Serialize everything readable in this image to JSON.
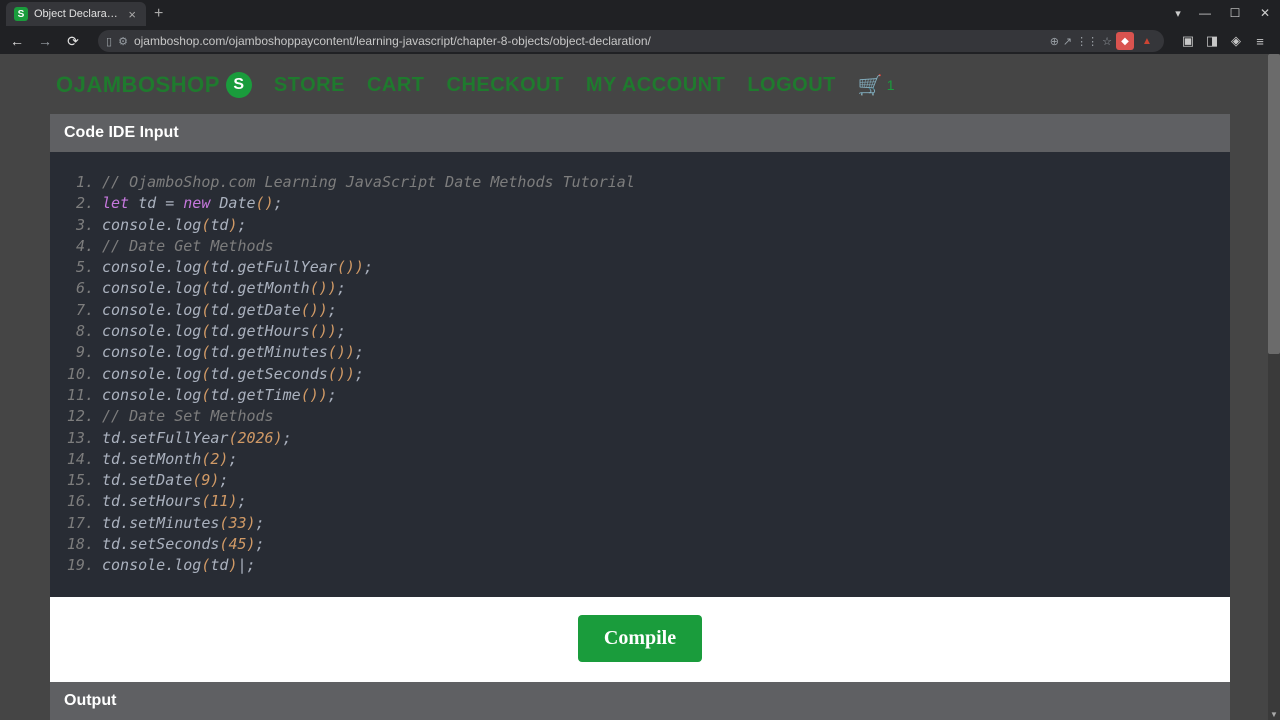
{
  "browser": {
    "tab_title": "Object Declaration - Ojamb",
    "url": "ojamboshop.com/ojamboshoppaycontent/learning-javascript/chapter-8-objects/object-declaration/"
  },
  "header": {
    "brand": "OJAMBOSHOP",
    "nav": [
      "STORE",
      "CART",
      "CHECKOUT",
      "MY ACCOUNT",
      "LOGOUT"
    ],
    "cart_count": "1"
  },
  "panel": {
    "title": "Code IDE Input"
  },
  "code": {
    "lines": [
      {
        "n": 1,
        "tokens": [
          [
            "comment",
            "// OjamboShop.com Learning JavaScript Date Methods Tutorial"
          ]
        ]
      },
      {
        "n": 2,
        "tokens": [
          [
            "kw",
            "let"
          ],
          [
            "plain",
            " "
          ],
          [
            "id",
            "td"
          ],
          [
            "plain",
            " = "
          ],
          [
            "kw",
            "new"
          ],
          [
            "plain",
            " "
          ],
          [
            "id",
            "Date"
          ],
          [
            "paren",
            "("
          ],
          [
            "paren",
            ")"
          ],
          [
            "plain",
            ";"
          ]
        ]
      },
      {
        "n": 3,
        "tokens": [
          [
            "id",
            "console"
          ],
          [
            "plain",
            "."
          ],
          [
            "fn",
            "log"
          ],
          [
            "paren",
            "("
          ],
          [
            "id",
            "td"
          ],
          [
            "paren",
            ")"
          ],
          [
            "plain",
            ";"
          ]
        ]
      },
      {
        "n": 4,
        "tokens": [
          [
            "comment",
            "// Date Get Methods"
          ]
        ]
      },
      {
        "n": 5,
        "tokens": [
          [
            "id",
            "console"
          ],
          [
            "plain",
            "."
          ],
          [
            "fn",
            "log"
          ],
          [
            "paren",
            "("
          ],
          [
            "id",
            "td"
          ],
          [
            "plain",
            "."
          ],
          [
            "id",
            "getFullYear"
          ],
          [
            "paren",
            "("
          ],
          [
            "paren",
            ")"
          ],
          [
            "paren",
            ")"
          ],
          [
            "plain",
            ";"
          ]
        ]
      },
      {
        "n": 6,
        "tokens": [
          [
            "id",
            "console"
          ],
          [
            "plain",
            "."
          ],
          [
            "fn",
            "log"
          ],
          [
            "paren",
            "("
          ],
          [
            "id",
            "td"
          ],
          [
            "plain",
            "."
          ],
          [
            "id",
            "getMonth"
          ],
          [
            "paren",
            "("
          ],
          [
            "paren",
            ")"
          ],
          [
            "paren",
            ")"
          ],
          [
            "plain",
            ";"
          ]
        ]
      },
      {
        "n": 7,
        "tokens": [
          [
            "id",
            "console"
          ],
          [
            "plain",
            "."
          ],
          [
            "fn",
            "log"
          ],
          [
            "paren",
            "("
          ],
          [
            "id",
            "td"
          ],
          [
            "plain",
            "."
          ],
          [
            "id",
            "getDate"
          ],
          [
            "paren",
            "("
          ],
          [
            "paren",
            ")"
          ],
          [
            "paren",
            ")"
          ],
          [
            "plain",
            ";"
          ]
        ]
      },
      {
        "n": 8,
        "tokens": [
          [
            "id",
            "console"
          ],
          [
            "plain",
            "."
          ],
          [
            "fn",
            "log"
          ],
          [
            "paren",
            "("
          ],
          [
            "id",
            "td"
          ],
          [
            "plain",
            "."
          ],
          [
            "id",
            "getHours"
          ],
          [
            "paren",
            "("
          ],
          [
            "paren",
            ")"
          ],
          [
            "paren",
            ")"
          ],
          [
            "plain",
            ";"
          ]
        ]
      },
      {
        "n": 9,
        "tokens": [
          [
            "id",
            "console"
          ],
          [
            "plain",
            "."
          ],
          [
            "fn",
            "log"
          ],
          [
            "paren",
            "("
          ],
          [
            "id",
            "td"
          ],
          [
            "plain",
            "."
          ],
          [
            "id",
            "getMinutes"
          ],
          [
            "paren",
            "("
          ],
          [
            "paren",
            ")"
          ],
          [
            "paren",
            ")"
          ],
          [
            "plain",
            ";"
          ]
        ]
      },
      {
        "n": 10,
        "tokens": [
          [
            "id",
            "console"
          ],
          [
            "plain",
            "."
          ],
          [
            "fn",
            "log"
          ],
          [
            "paren",
            "("
          ],
          [
            "id",
            "td"
          ],
          [
            "plain",
            "."
          ],
          [
            "id",
            "getSeconds"
          ],
          [
            "paren",
            "("
          ],
          [
            "paren",
            ")"
          ],
          [
            "paren",
            ")"
          ],
          [
            "plain",
            ";"
          ]
        ]
      },
      {
        "n": 11,
        "tokens": [
          [
            "id",
            "console"
          ],
          [
            "plain",
            "."
          ],
          [
            "fn",
            "log"
          ],
          [
            "paren",
            "("
          ],
          [
            "id",
            "td"
          ],
          [
            "plain",
            "."
          ],
          [
            "id",
            "getTime"
          ],
          [
            "paren",
            "("
          ],
          [
            "paren",
            ")"
          ],
          [
            "paren",
            ")"
          ],
          [
            "plain",
            ";"
          ]
        ]
      },
      {
        "n": 12,
        "tokens": [
          [
            "comment",
            "// Date Set Methods"
          ]
        ]
      },
      {
        "n": 13,
        "tokens": [
          [
            "id",
            "td"
          ],
          [
            "plain",
            "."
          ],
          [
            "id",
            "setFullYear"
          ],
          [
            "paren",
            "("
          ],
          [
            "num",
            "2026"
          ],
          [
            "paren",
            ")"
          ],
          [
            "plain",
            ";"
          ]
        ]
      },
      {
        "n": 14,
        "tokens": [
          [
            "id",
            "td"
          ],
          [
            "plain",
            "."
          ],
          [
            "id",
            "setMonth"
          ],
          [
            "paren",
            "("
          ],
          [
            "num",
            "2"
          ],
          [
            "paren",
            ")"
          ],
          [
            "plain",
            ";"
          ]
        ]
      },
      {
        "n": 15,
        "tokens": [
          [
            "id",
            "td"
          ],
          [
            "plain",
            "."
          ],
          [
            "id",
            "setDate"
          ],
          [
            "paren",
            "("
          ],
          [
            "num",
            "9"
          ],
          [
            "paren",
            ")"
          ],
          [
            "plain",
            ";"
          ]
        ]
      },
      {
        "n": 16,
        "tokens": [
          [
            "id",
            "td"
          ],
          [
            "plain",
            "."
          ],
          [
            "id",
            "setHours"
          ],
          [
            "paren",
            "("
          ],
          [
            "num",
            "11"
          ],
          [
            "paren",
            ")"
          ],
          [
            "plain",
            ";"
          ]
        ]
      },
      {
        "n": 17,
        "tokens": [
          [
            "id",
            "td"
          ],
          [
            "plain",
            "."
          ],
          [
            "id",
            "setMinutes"
          ],
          [
            "paren",
            "("
          ],
          [
            "num",
            "33"
          ],
          [
            "paren",
            ")"
          ],
          [
            "plain",
            ";"
          ]
        ]
      },
      {
        "n": 18,
        "tokens": [
          [
            "id",
            "td"
          ],
          [
            "plain",
            "."
          ],
          [
            "id",
            "setSeconds"
          ],
          [
            "paren",
            "("
          ],
          [
            "num",
            "45"
          ],
          [
            "paren",
            ")"
          ],
          [
            "plain",
            ";"
          ]
        ]
      },
      {
        "n": 19,
        "tokens": [
          [
            "id",
            "console"
          ],
          [
            "plain",
            "."
          ],
          [
            "fn",
            "log"
          ],
          [
            "paren",
            "("
          ],
          [
            "id",
            "td"
          ],
          [
            "paren",
            ")"
          ],
          [
            "plain",
            "|;"
          ]
        ]
      }
    ]
  },
  "compile_label": "Compile",
  "output_title": "Output"
}
